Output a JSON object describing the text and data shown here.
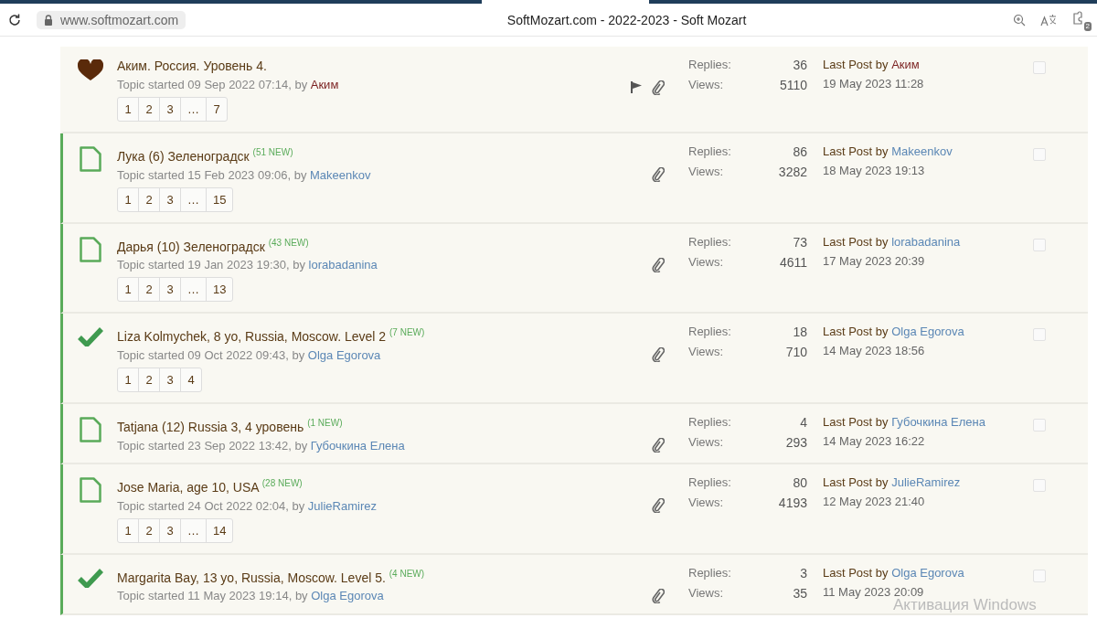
{
  "browser": {
    "url": "www.softmozart.com",
    "title": "SoftMozart.com - 2022-2023 - Soft Mozart",
    "badge": "2"
  },
  "topics": [
    {
      "kind": "favorite",
      "unread": false,
      "title": "Аким. Россия. Уровень 4.",
      "started": "Topic started 09 Sep 2022 07:14, by",
      "author": {
        "name": "Аким",
        "color": "#7a1f1f"
      },
      "pages": [
        "1",
        "2",
        "3",
        "…",
        "7"
      ],
      "flag": true,
      "attachment": true,
      "replies_label": "Replies:",
      "replies": "36",
      "views_label": "Views:",
      "views": "5110",
      "last_label": "Last Post by",
      "last_by": {
        "name": "Аким",
        "color": "#7a1f1f"
      },
      "last_date": "19 May 2023 11:28",
      "checked": false
    },
    {
      "kind": "topic",
      "unread": true,
      "title": "Лука (6) Зеленоградск",
      "new_count": "(51 NEW)",
      "started": "Topic started 15 Feb 2023 09:06, by",
      "author": {
        "name": "Makeenkov",
        "color": "#5b87b5"
      },
      "pages": [
        "1",
        "2",
        "3",
        "…",
        "15"
      ],
      "flag": false,
      "attachment": true,
      "replies_label": "Replies:",
      "replies": "86",
      "views_label": "Views:",
      "views": "3282",
      "last_label": "Last Post by",
      "last_by": {
        "name": "Makeenkov",
        "color": "#5b87b5"
      },
      "last_date": "18 May 2023 19:13",
      "checked": false
    },
    {
      "kind": "topic",
      "unread": true,
      "title": "Дарья (10) Зеленоградск",
      "new_count": "(43 NEW)",
      "started": "Topic started 19 Jan 2023 19:30, by",
      "author": {
        "name": "lorabadanina",
        "color": "#5b87b5"
      },
      "pages": [
        "1",
        "2",
        "3",
        "…",
        "13"
      ],
      "flag": false,
      "attachment": true,
      "replies_label": "Replies:",
      "replies": "73",
      "views_label": "Views:",
      "views": "4611",
      "last_label": "Last Post by",
      "last_by": {
        "name": "lorabadanina",
        "color": "#5b87b5"
      },
      "last_date": "17 May 2023 20:39",
      "checked": false
    },
    {
      "kind": "answered",
      "unread": true,
      "title": "Liza Kolmychek, 8 yo, Russia, Moscow. Level 2",
      "new_count": "(7 NEW)",
      "started": "Topic started 09 Oct 2022 09:43, by",
      "author": {
        "name": "Olga Egorova",
        "color": "#5b87b5"
      },
      "pages": [
        "1",
        "2",
        "3",
        "4"
      ],
      "flag": false,
      "attachment": true,
      "replies_label": "Replies:",
      "replies": "18",
      "views_label": "Views:",
      "views": "710",
      "last_label": "Last Post by",
      "last_by": {
        "name": "Olga Egorova",
        "color": "#5b87b5"
      },
      "last_date": "14 May 2023 18:56",
      "checked": false
    },
    {
      "kind": "topic",
      "unread": true,
      "title": "Tatjana (12) Russia 3, 4 уровень",
      "new_count": "(1 NEW)",
      "started": "Topic started 23 Sep 2022 13:42, by",
      "author": {
        "name": "Губочкина Елена",
        "color": "#5b87b5"
      },
      "flag": false,
      "attachment": true,
      "replies_label": "Replies:",
      "replies": "4",
      "views_label": "Views:",
      "views": "293",
      "last_label": "Last Post by",
      "last_by": {
        "name": "Губочкина Елена",
        "color": "#5b87b5"
      },
      "last_date": "14 May 2023 16:22",
      "checked": false
    },
    {
      "kind": "topic",
      "unread": true,
      "title": "Jose Maria, age 10, USA",
      "new_count": "(28 NEW)",
      "started": "Topic started 24 Oct 2022 02:04, by",
      "author": {
        "name": "JulieRamirez",
        "color": "#5b87b5"
      },
      "pages": [
        "1",
        "2",
        "3",
        "…",
        "14"
      ],
      "flag": false,
      "attachment": true,
      "replies_label": "Replies:",
      "replies": "80",
      "views_label": "Views:",
      "views": "4193",
      "last_label": "Last Post by",
      "last_by": {
        "name": "JulieRamirez",
        "color": "#5b87b5"
      },
      "last_date": "12 May 2023 21:40",
      "checked": false
    },
    {
      "kind": "answered",
      "unread": true,
      "title": "Margarita Bay, 13 yo, Russia, Moscow. Level 5.",
      "new_count": "(4 NEW)",
      "started": "Topic started 11 May 2023 19:14, by",
      "author": {
        "name": "Olga Egorova",
        "color": "#5b87b5"
      },
      "flag": false,
      "attachment": true,
      "replies_label": "Replies:",
      "replies": "3",
      "views_label": "Views:",
      "views": "35",
      "last_label": "Last Post by",
      "last_by": {
        "name": "Olga Egorova",
        "color": "#5b87b5"
      },
      "last_date": "11 May 2023 20:09",
      "checked": false
    }
  ],
  "os_notice": "Активация Windows"
}
